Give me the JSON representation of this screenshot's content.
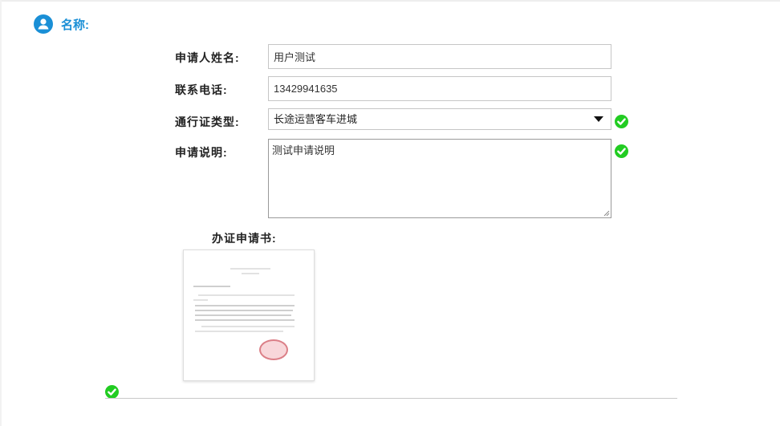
{
  "section": {
    "icon": "user-circle-icon",
    "title": "名称:",
    "accent_color": "#1a8fd6"
  },
  "form": {
    "applicant_name": {
      "label": "申请人姓名:",
      "value": "用户测试"
    },
    "phone": {
      "label": "联系电话:",
      "value": "13429941635"
    },
    "pass_type": {
      "label": "通行证类型:",
      "selected": "长途运营客车进城"
    },
    "description": {
      "label": "申请说明:",
      "value": "测试申请说明"
    }
  },
  "certificate": {
    "label": "办证申请书:"
  },
  "status": {
    "valid_icon": "check-circle-icon",
    "valid_color": "#22cc22"
  }
}
